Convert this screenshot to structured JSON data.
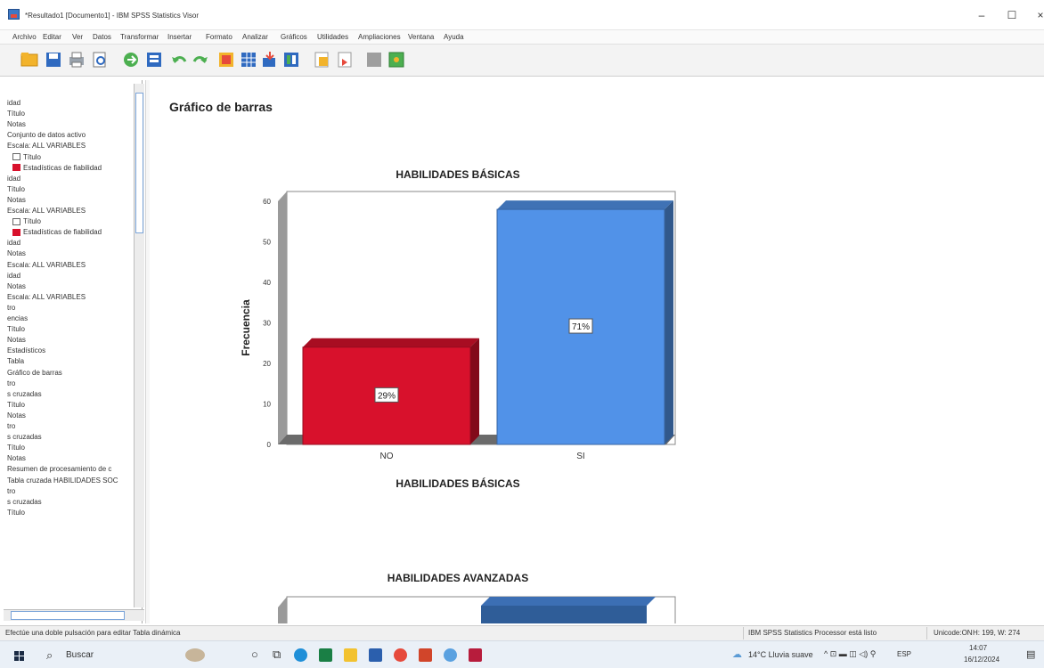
{
  "window": {
    "title": "*Resultado1 [Documento1] - IBM SPSS Statistics Visor",
    "minimize": "–",
    "maximize": "☐",
    "close": "×"
  },
  "menu": [
    "Archivo",
    "Editar",
    "Ver",
    "Datos",
    "Transformar",
    "Insertar",
    "Formato",
    "Analizar",
    "Gráficos",
    "Utilidades",
    "Ampliaciones",
    "Ventana",
    "Ayuda"
  ],
  "toolbar": {
    "icons": [
      "open-icon",
      "save-icon",
      "print-icon",
      "print-preview-icon",
      "export-icon",
      "recall-dialog-icon",
      "undo-icon",
      "redo-icon",
      "goto-data-icon",
      "goto-case-icon",
      "goto-variable-icon",
      "variables-icon",
      "insert-output-icon",
      "insert-title-icon",
      "show-all-icon",
      "designate-window-icon"
    ]
  },
  "outline": {
    "items": [
      "idad",
      "Título",
      "Notas",
      "Conjunto de datos activo",
      "Escala: ALL VARIABLES",
      "Título",
      "Estadísticas de fiabilidad",
      "idad",
      "Título",
      "Notas",
      "Escala: ALL VARIABLES",
      "Título",
      "Estadísticas de fiabilidad",
      "idad",
      "Notas",
      "Escala: ALL VARIABLES",
      "idad",
      "Notas",
      "Escala: ALL VARIABLES",
      "tro",
      "encias",
      "Título",
      "Notas",
      "Estadísticos",
      "Tabla",
      "Gráfico de barras",
      "tro",
      "s cruzadas",
      "Título",
      "Notas",
      "tro",
      "s cruzadas",
      "Título",
      "Notas",
      "Resumen de procesamiento de c",
      "Tabla cruzada HABILIDADES SOC",
      "tro",
      "s cruzadas",
      "Título"
    ]
  },
  "viewer": {
    "heading": "Gráfico de barras"
  },
  "chart_data": [
    {
      "type": "bar",
      "title": "HABILIDADES BÁSICAS",
      "xlabel": "HABILIDADES BÁSICAS",
      "ylabel": "Frecuencia",
      "categories": [
        "NO",
        "SI"
      ],
      "values": [
        24,
        58
      ],
      "data_labels": [
        "29%",
        "71%"
      ],
      "colors": [
        "#d8112c",
        "#5192e8"
      ],
      "yticks": [
        0,
        10,
        20,
        30,
        40,
        50,
        60
      ],
      "ylim": [
        0,
        60
      ],
      "grid": false,
      "style": "3d"
    },
    {
      "type": "bar",
      "title": "HABILIDADES AVANZADAS",
      "partial": true
    }
  ],
  "status": {
    "hint": "Efectúe una doble pulsación para editar Tabla dinámica",
    "processor": "IBM SPSS Statistics Processor está listo",
    "unicode": "Unicode:ON",
    "dims": "H: 199, W: 274"
  },
  "taskbar": {
    "search": "Buscar",
    "weather": "14°C Lluvia suave",
    "lang": "ESP",
    "time": "14:07",
    "date": "16/12/2024"
  },
  "colors": {
    "bar_no": "#d8112c",
    "bar_si": "#5192e8",
    "floor": "#6b6b6b"
  }
}
